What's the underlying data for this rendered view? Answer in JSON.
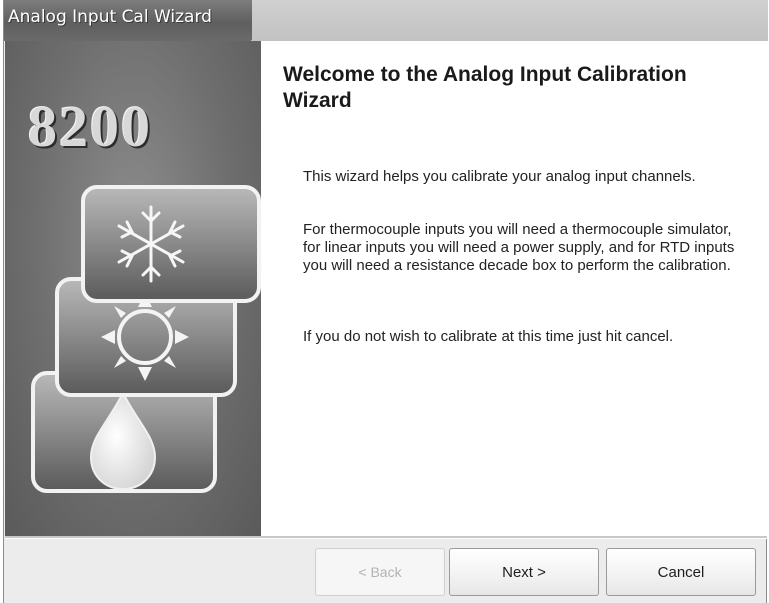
{
  "window": {
    "title": "Analog Input Cal Wizard"
  },
  "banner": {
    "brand": "8200",
    "icons": [
      "snowflake-icon",
      "sun-icon",
      "water-drop-icon"
    ]
  },
  "content": {
    "heading": "Welcome to the Analog Input Calibration Wizard",
    "paragraphs": [
      "This wizard helps you calibrate your analog input channels.",
      "For thermocouple inputs you will need a thermocouple simulator, for linear inputs you will need a power supply, and for RTD inputs you will need a resistance decade box to perform the calibration.",
      "If you do not wish to calibrate at this time just hit cancel."
    ]
  },
  "buttons": {
    "back": "< Back",
    "next": "Next >",
    "cancel": "Cancel"
  },
  "colors": {
    "title_bar": "#6b6b6b",
    "banner": "#767676",
    "content_bg": "#ffffff",
    "dialog_bg": "#ececec"
  }
}
